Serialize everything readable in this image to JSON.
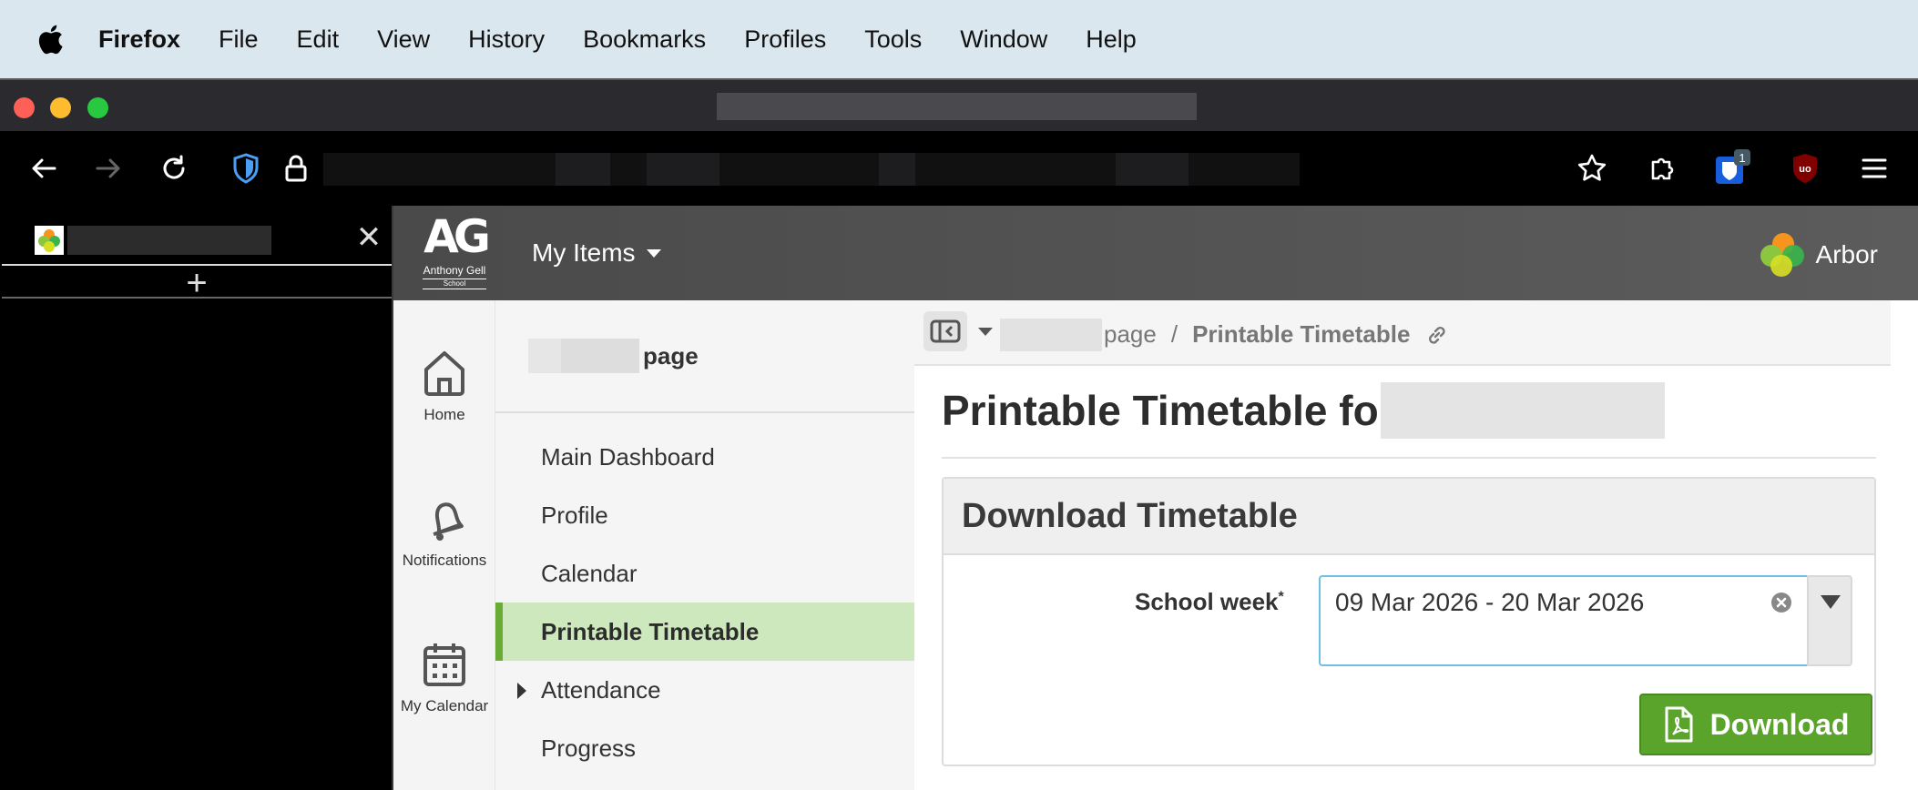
{
  "menubar": {
    "app": "Firefox",
    "items": [
      "File",
      "Edit",
      "View",
      "History",
      "Bookmarks",
      "Profiles",
      "Tools",
      "Window",
      "Help"
    ]
  },
  "toolbar": {
    "extension_badge": "1",
    "ublock_label": "uo"
  },
  "sidebar": {
    "new_tab": "+",
    "close": "✕"
  },
  "header": {
    "school_logo_letters": "AG",
    "school_name": "Anthony Gell",
    "school_subtitle": "School",
    "my_items": "My Items",
    "brand": "Arbor"
  },
  "iconnav": {
    "items": [
      {
        "label": "Home",
        "icon": "home-icon"
      },
      {
        "label": "Notifications",
        "icon": "bell-icon"
      },
      {
        "label": "My Calendar",
        "icon": "calendar-icon"
      }
    ]
  },
  "subnav": {
    "heading_suffix": "page",
    "items": [
      {
        "label": "Main Dashboard"
      },
      {
        "label": "Profile"
      },
      {
        "label": "Calendar"
      },
      {
        "label": "Printable Timetable",
        "active": true
      },
      {
        "label": "Attendance",
        "expandable": true
      },
      {
        "label": "Progress"
      }
    ]
  },
  "breadcrumb": {
    "parent_suffix": "page",
    "separator": "/",
    "current": "Printable Timetable"
  },
  "main": {
    "title_prefix": "Printable Timetable for",
    "panel_title": "Download Timetable",
    "field_label": "School week",
    "field_required_mark": "*",
    "field_value": "09 Mar 2026 - 20 Mar 2026",
    "download_label": "Download"
  },
  "colors": {
    "accent_green": "#5ba42c",
    "active_nav_bg": "#cde8bd",
    "focus_border": "#6ec1e4"
  }
}
